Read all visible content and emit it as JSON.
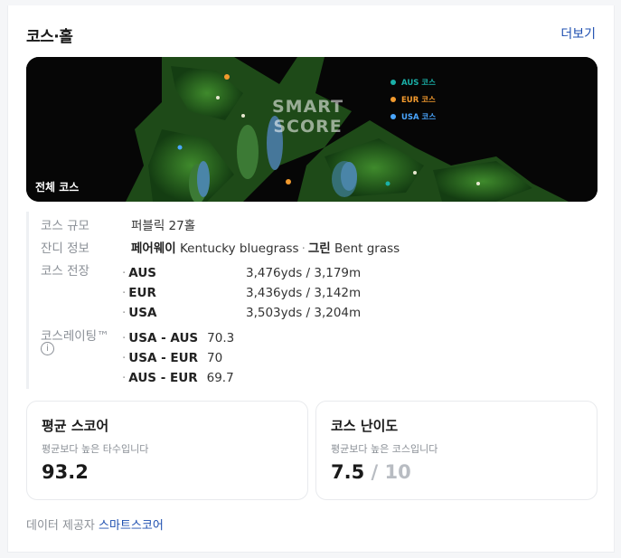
{
  "header": {
    "title": "코스·홀",
    "more_label": "더보기"
  },
  "map": {
    "label": "전체 코스",
    "watermark_line1": "SMART",
    "watermark_line2": "SCORE",
    "legend": [
      {
        "label": "AUS 코스",
        "color": "#1ab0a8"
      },
      {
        "label": "EUR 코스",
        "color": "#f29a2e"
      },
      {
        "label": "USA 코스",
        "color": "#4aa6ff"
      }
    ]
  },
  "info": {
    "scale_label": "코스 규모",
    "scale_value": "퍼블릭 27홀",
    "grass_label": "잔디 정보",
    "grass_fairway_label": "페어웨이",
    "grass_fairway_value": "Kentucky bluegrass",
    "grass_green_label": "그린",
    "grass_green_value": "Bent grass",
    "length_label": "코스 전장",
    "lengths": [
      {
        "course": "AUS",
        "value": "3,476yds / 3,179m"
      },
      {
        "course": "EUR",
        "value": "3,436yds / 3,142m"
      },
      {
        "course": "USA",
        "value": "3,503yds / 3,204m"
      }
    ],
    "rating_label": "코스레이팅™",
    "info_icon": "i",
    "ratings": [
      {
        "combo": "USA - AUS",
        "value": "70.3"
      },
      {
        "combo": "USA - EUR",
        "value": "70"
      },
      {
        "combo": "AUS - EUR",
        "value": "69.7"
      }
    ]
  },
  "stats": {
    "avg_title": "평균 스코어",
    "avg_desc": "평균보다 높은 타수입니다",
    "avg_value": "93.2",
    "diff_title": "코스 난이도",
    "diff_desc": "평균보다 높은 코스입니다",
    "diff_value": "7.5",
    "diff_sep": "/",
    "diff_max": "10"
  },
  "footer": {
    "provider_label": "데이터 제공자",
    "provider_link": "스마트스코어"
  }
}
